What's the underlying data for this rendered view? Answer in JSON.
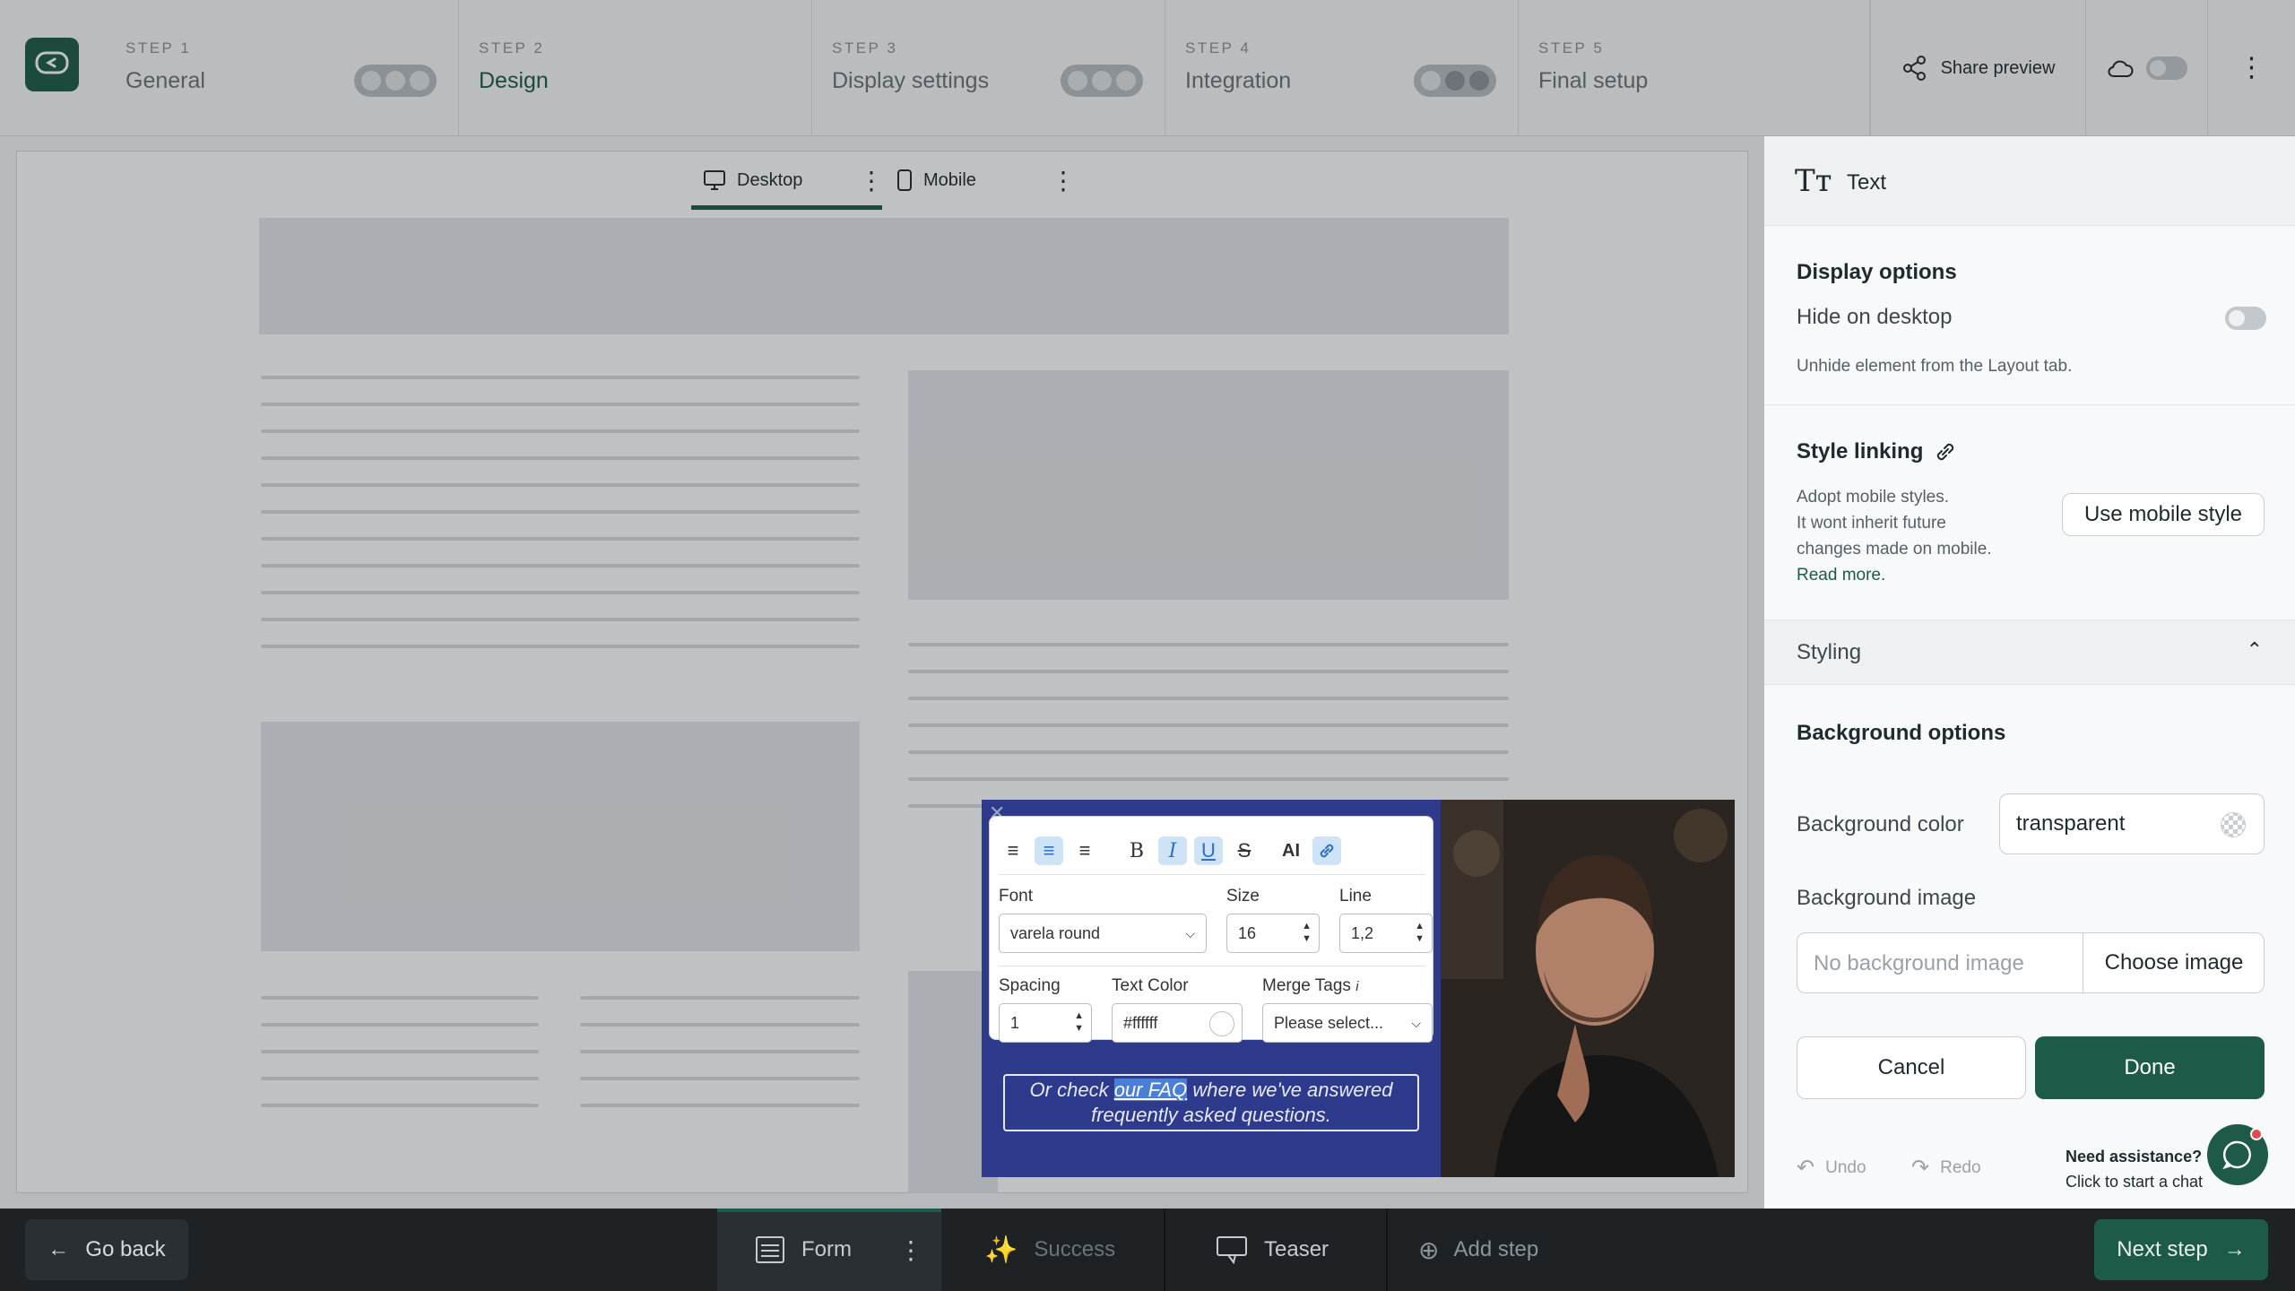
{
  "header": {
    "steps": [
      {
        "num": "STEP 1",
        "title": "General"
      },
      {
        "num": "STEP 2",
        "title": "Design"
      },
      {
        "num": "STEP 3",
        "title": "Display settings"
      },
      {
        "num": "STEP 4",
        "title": "Integration"
      },
      {
        "num": "STEP 5",
        "title": "Final setup"
      }
    ],
    "share_preview": "Share preview"
  },
  "device_tabs": {
    "desktop": "Desktop",
    "mobile": "Mobile"
  },
  "popup": {
    "toolbar": {
      "font_label": "Font",
      "font_value": "varela round",
      "size_label": "Size",
      "size_value": "16",
      "line_label": "Line",
      "line_value": "1,2",
      "spacing_label": "Spacing",
      "spacing_value": "1",
      "text_color_label": "Text Color",
      "text_color_value": "#ffffff",
      "merge_tags_label": "Merge Tags",
      "merge_tags_value": "Please select...",
      "ai_label": "AI"
    },
    "text_before": "Or check",
    "link_text": "our FAQ",
    "text_after": "where we've answered",
    "text_line2": "frequently asked questions."
  },
  "panel": {
    "title": "Text",
    "display_options": {
      "heading": "Display options",
      "hide_on_desktop": "Hide on desktop",
      "hint": "Unhide element from the Layout tab."
    },
    "style_linking": {
      "heading": "Style linking",
      "desc1": "Adopt mobile styles.",
      "desc2": "It wont inherit future",
      "desc3": "changes made on mobile.",
      "read_more": "Read more.",
      "use_mobile_style": "Use mobile style"
    },
    "styling": {
      "heading": "Styling",
      "background_options": "Background options",
      "background_color_label": "Background color",
      "background_color_value": "transparent",
      "background_image_label": "Background image",
      "background_image_placeholder": "No background image",
      "choose_image": "Choose image"
    },
    "cancel": "Cancel",
    "done": "Done",
    "undo": "Undo",
    "redo": "Redo",
    "assist_title": "Need assistance?",
    "assist_sub": "Click to start a chat"
  },
  "footer": {
    "go_back": "Go back",
    "tabs": {
      "form": "Form",
      "success": "Success",
      "teaser": "Teaser",
      "add_step": "Add step"
    },
    "next_step": "Next step"
  },
  "colors": {
    "brand": "#1e5a48",
    "popup_bg": "#2e3a8c",
    "link_highlight": "#4a7fd8"
  }
}
